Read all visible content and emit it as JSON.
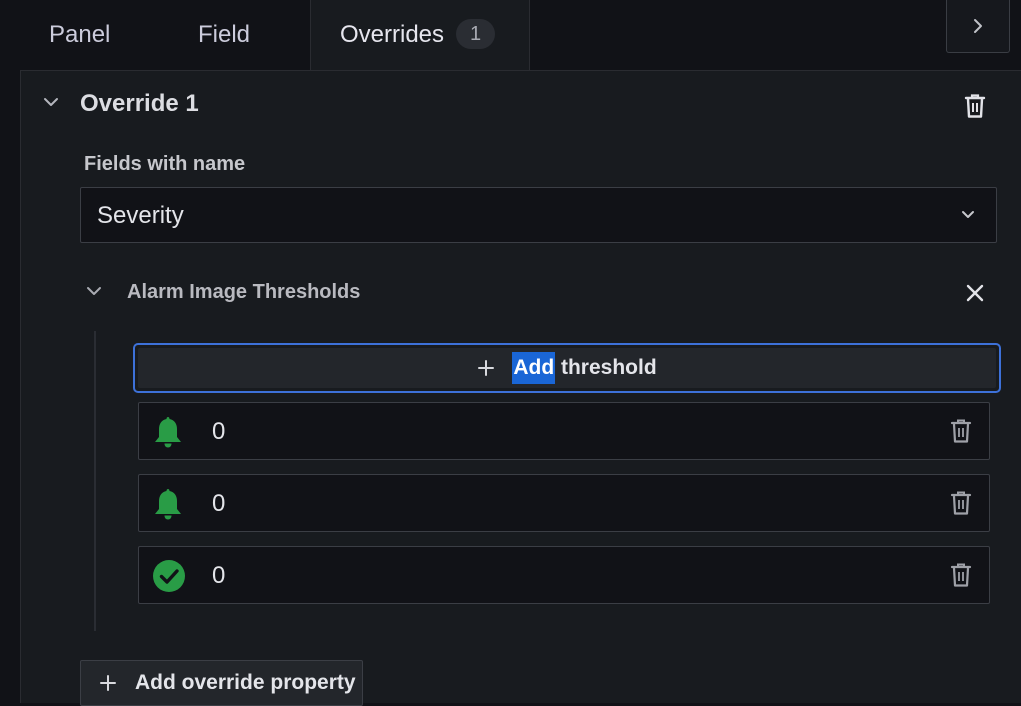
{
  "tabs": [
    {
      "label": "Panel"
    },
    {
      "label": "Field"
    },
    {
      "label": "Overrides",
      "badge": "1"
    }
  ],
  "override": {
    "title": "Override 1",
    "matcher_label": "Fields with name",
    "matcher_value": "Severity",
    "property": {
      "title": "Alarm Image Thresholds",
      "add_threshold": {
        "selected_word": "Add",
        "rest": " threshold"
      },
      "thresholds": [
        {
          "icon": "bell-icon",
          "value": "0",
          "color": "#299c46"
        },
        {
          "icon": "bell-icon",
          "value": "0",
          "color": "#299c46"
        },
        {
          "icon": "check-circle-icon",
          "value": "0",
          "color": "#299c46"
        }
      ]
    },
    "add_property_label": "Add override property"
  },
  "colors": {
    "accent_focus": "#3d71d9",
    "selection": "#1a66d6",
    "ok_green": "#299c46"
  }
}
